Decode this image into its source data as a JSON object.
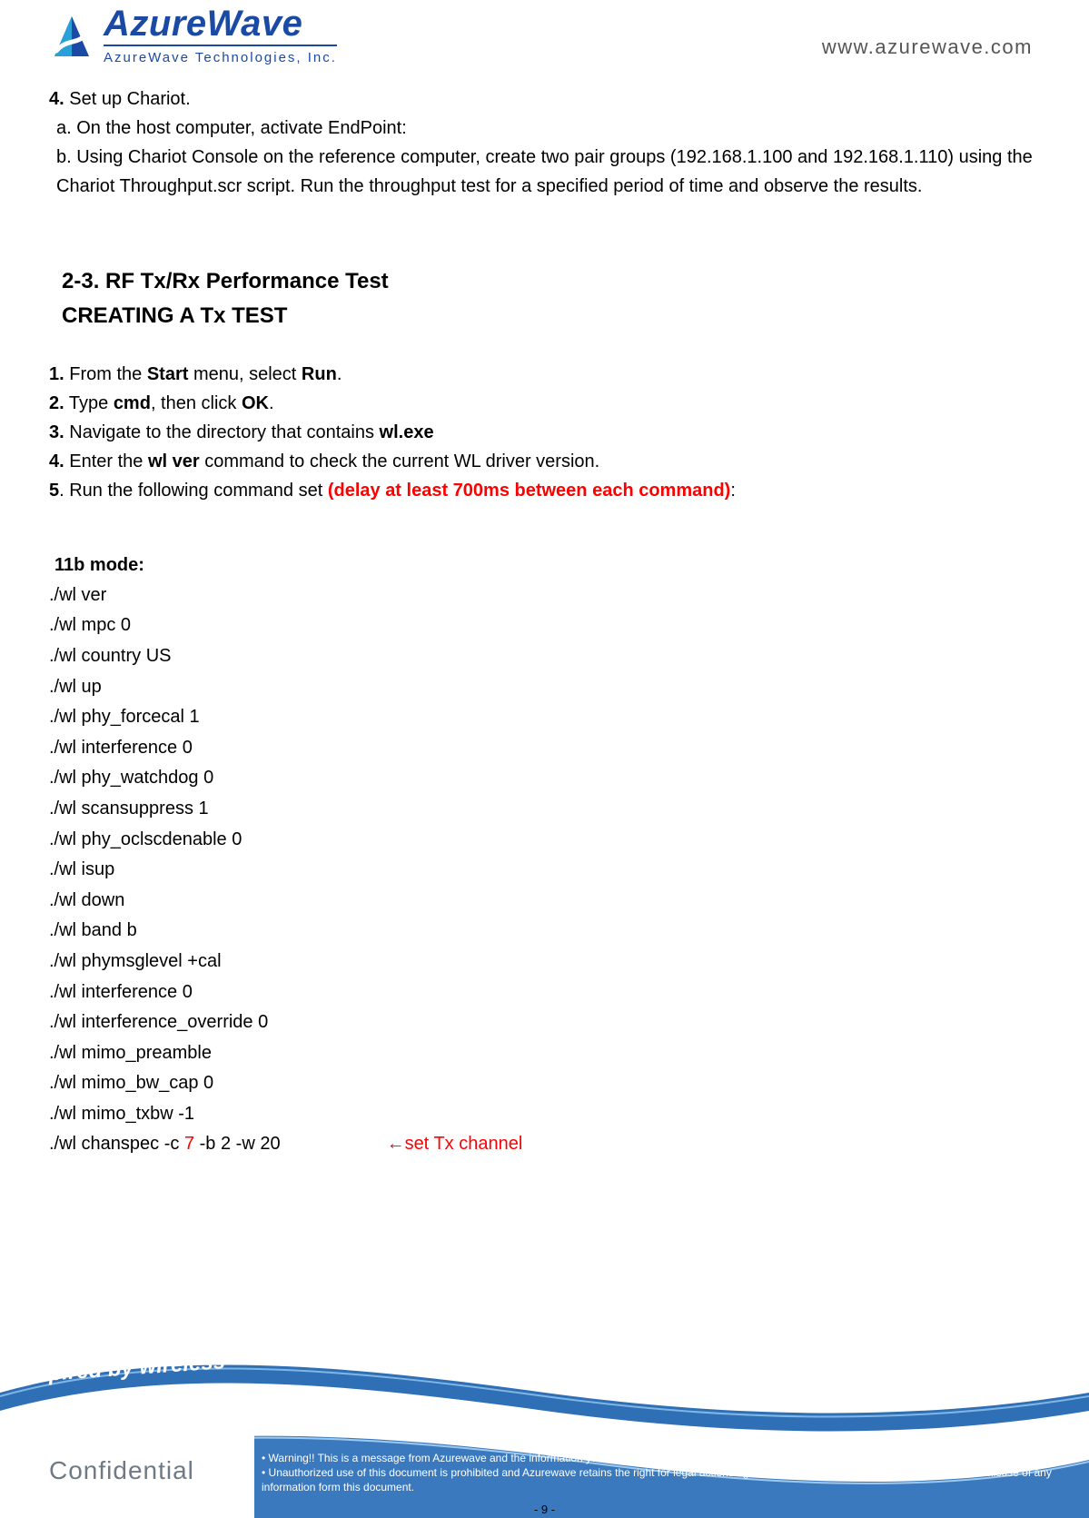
{
  "header": {
    "brand": "AzureWave",
    "tagline": "AzureWave   Technologies,   Inc.",
    "url": "www.azurewave.com"
  },
  "section4": {
    "label": "4.",
    "text": " Set up Chariot.",
    "a": "a. On the host computer, activate EndPoint:",
    "b": "b. Using Chariot Console on the reference computer, create two pair groups (192.168.1.100 and 192.168.1.110) using the Chariot Throughput.scr script. Run the throughput test for a specified period of time and observe the results."
  },
  "section23": {
    "heading": "2-3. RF Tx/Rx Performance Test",
    "subheading": "CREATING A Tx TEST"
  },
  "txSteps": {
    "s1": {
      "num": "1.",
      "pre": " From the ",
      "b1": "Start",
      "mid": " menu, select ",
      "b2": "Run",
      "post": "."
    },
    "s2": {
      "num": "2.",
      "pre": " Type ",
      "b1": "cmd",
      "mid": ", then click ",
      "b2": "OK",
      "post": "."
    },
    "s3": {
      "num": "3.",
      "pre": " Navigate to the directory that contains ",
      "b1": "wl.exe"
    },
    "s4": {
      "num": "4.",
      "pre": " Enter the ",
      "b1": "wl ver",
      "post": " command to check the current WL driver version."
    },
    "s5": {
      "num": "5",
      "pre": ". Run the following command set ",
      "warn": "(delay at least 700ms between each command)",
      "post": ":"
    }
  },
  "mode11b": {
    "label": "11b mode:",
    "cmds": [
      "./wl ver",
      "./wl mpc 0",
      "./wl country US",
      "./wl up",
      "./wl phy_forcecal 1",
      "./wl interference 0",
      "./wl phy_watchdog 0",
      "./wl scansuppress 1",
      "./wl phy_oclscdenable 0",
      "./wl isup",
      "./wl down",
      "./wl band b",
      "./wl phymsglevel +cal",
      "./wl interference 0",
      "./wl interference_override 0",
      "./wl mimo_preamble",
      "./wl mimo_bw_cap 0",
      "./wl mimo_txbw -1"
    ],
    "chanspec": {
      "pre": "./wl chanspec -c ",
      "ch": "7",
      "post": " -b 2 -w 20",
      "arrow": "Ç",
      "note": "set Tx channel"
    }
  },
  "footer": {
    "inspired": "Inspired by wireless",
    "confidential": "Confidential",
    "warn1": "Warning!! This is a message from Azurewave and the information you are viewing now is strictly confidential and is a knowledge property to Azurewave.",
    "warn2": "Unauthorized use of this document is prohibited and Azurewave retains the right for legal actions against any loss suffered or expenditure due to the misuse of any information form this document.",
    "pageNum": "- 9 -"
  }
}
